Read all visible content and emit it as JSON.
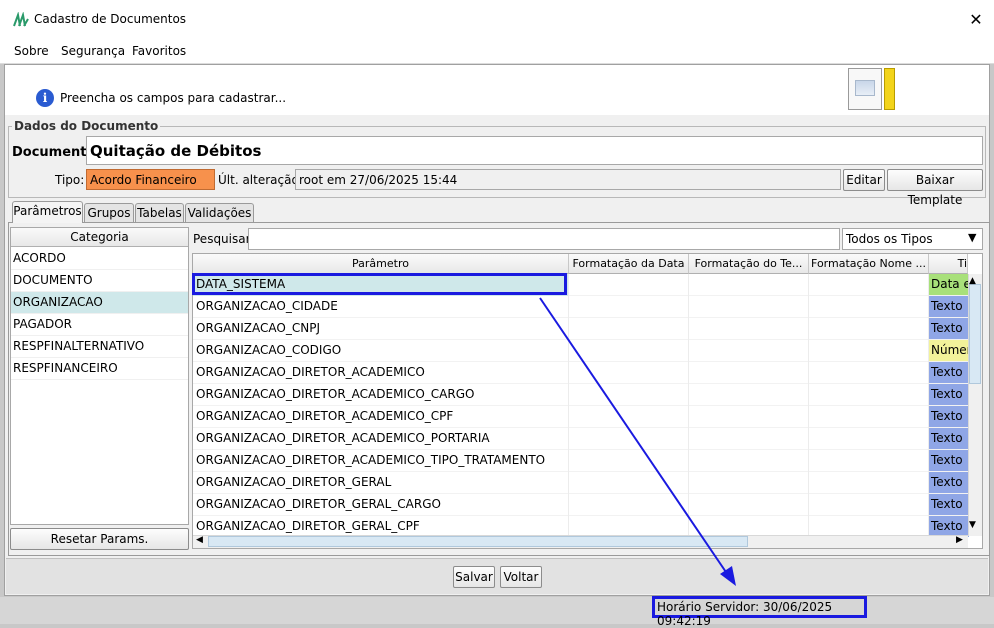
{
  "window": {
    "title": "Cadastro de Documentos",
    "close_glyph": "✕"
  },
  "menu": {
    "items": [
      "Sobre",
      "Segurança",
      "Favoritos"
    ]
  },
  "info": {
    "message": "Preencha os campos para cadastrar...",
    "icon_glyph": "i"
  },
  "doc": {
    "group_title": "Dados do Documento",
    "documento_label": "Documento:",
    "documento_value": "Quitação de Débitos",
    "tipo_label": "Tipo:",
    "tipo_value": "Acordo Financeiro",
    "tipo_color": "#f7914c",
    "ult_label": "Últ. alteração:",
    "ult_value": "root em 27/06/2025 15:44",
    "edit_label": "Editar",
    "baixar_label": "Baixar Template"
  },
  "tabs": [
    "Parâmetros",
    "Grupos",
    "Tabelas",
    "Validações"
  ],
  "categories": {
    "header": "Categoria",
    "items": [
      "ACORDO",
      "DOCUMENTO",
      "ORGANIZACAO",
      "PAGADOR",
      "RESPFINALTERNATIVO",
      "RESPFINANCEIRO"
    ],
    "selected": "ORGANIZACAO",
    "reset_label": "Resetar Params."
  },
  "search": {
    "label": "Pesquisar:",
    "value": "",
    "type_filter": "Todos os Tipos"
  },
  "table": {
    "columns": [
      "Parâmetro",
      "Formatação da Data",
      "Formatação do Te...",
      "Formatação Nome ...",
      "Ti"
    ],
    "rows": [
      {
        "param": "DATA_SISTEMA",
        "tipo": "Data e",
        "tipo_color": "#a8e07a"
      },
      {
        "param": "ORGANIZACAO_CIDADE",
        "tipo": "Texto",
        "tipo_color": "#8fa6e6"
      },
      {
        "param": "ORGANIZACAO_CNPJ",
        "tipo": "Texto",
        "tipo_color": "#8fa6e6"
      },
      {
        "param": "ORGANIZACAO_CODIGO",
        "tipo": "Númer",
        "tipo_color": "#f2f29a"
      },
      {
        "param": "ORGANIZACAO_DIRETOR_ACADEMICO",
        "tipo": "Texto",
        "tipo_color": "#8fa6e6"
      },
      {
        "param": "ORGANIZACAO_DIRETOR_ACADEMICO_CARGO",
        "tipo": "Texto",
        "tipo_color": "#8fa6e6"
      },
      {
        "param": "ORGANIZACAO_DIRETOR_ACADEMICO_CPF",
        "tipo": "Texto",
        "tipo_color": "#8fa6e6"
      },
      {
        "param": "ORGANIZACAO_DIRETOR_ACADEMICO_PORTARIA",
        "tipo": "Texto",
        "tipo_color": "#8fa6e6"
      },
      {
        "param": "ORGANIZACAO_DIRETOR_ACADEMICO_TIPO_TRATAMENTO",
        "tipo": "Texto",
        "tipo_color": "#8fa6e6"
      },
      {
        "param": "ORGANIZACAO_DIRETOR_GERAL",
        "tipo": "Texto",
        "tipo_color": "#8fa6e6"
      },
      {
        "param": "ORGANIZACAO_DIRETOR_GERAL_CARGO",
        "tipo": "Texto",
        "tipo_color": "#8fa6e6"
      },
      {
        "param": "ORGANIZACAO_DIRETOR_GERAL_CPF",
        "tipo": "Texto",
        "tipo_color": "#8fa6e6"
      }
    ],
    "selected_row": "DATA_SISTEMA"
  },
  "footer": {
    "salvar_label": "Salvar",
    "voltar_label": "Voltar",
    "server_time": "Horário Servidor: 30/06/2025 09:42:19"
  },
  "annotation_color": "#1a1ae0"
}
